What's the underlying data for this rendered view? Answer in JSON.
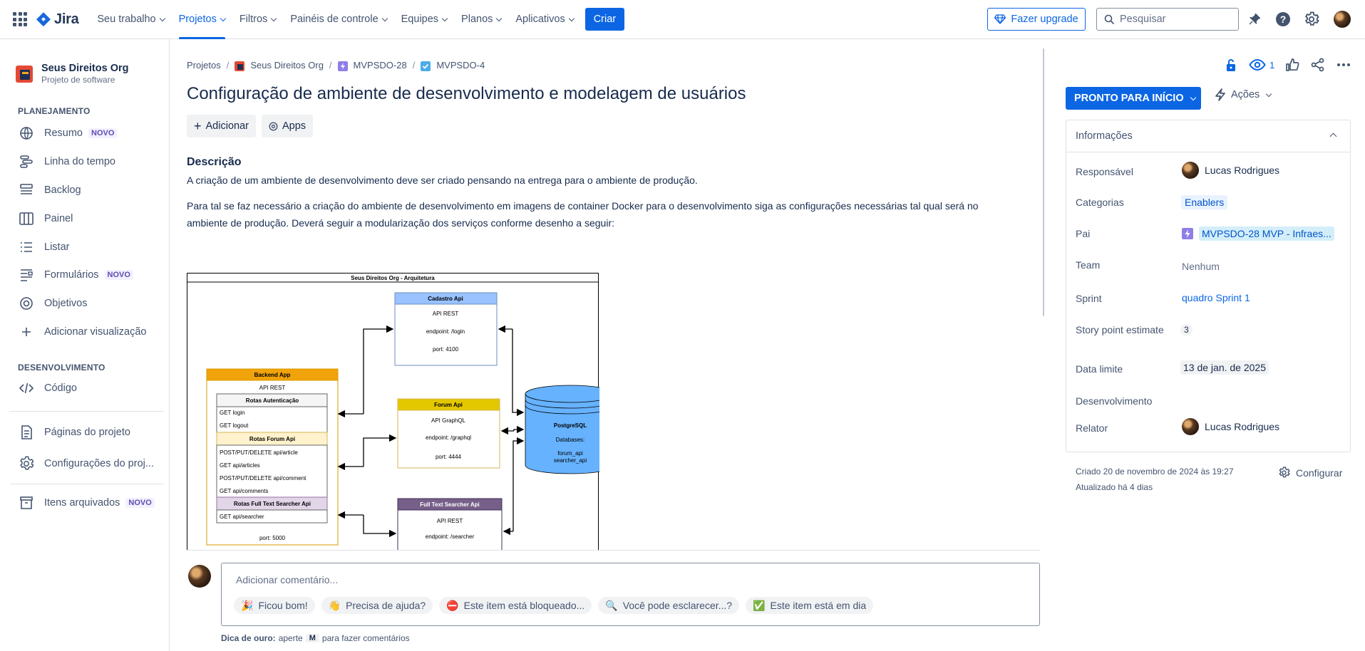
{
  "topnav": {
    "logo_text": "Jira",
    "items": [
      {
        "label": "Seu trabalho",
        "active": false
      },
      {
        "label": "Projetos",
        "active": true
      },
      {
        "label": "Filtros",
        "active": false
      },
      {
        "label": "Painéis de controle",
        "active": false
      },
      {
        "label": "Equipes",
        "active": false
      },
      {
        "label": "Planos",
        "active": false
      },
      {
        "label": "Aplicativos",
        "active": false
      }
    ],
    "create_label": "Criar",
    "upgrade_label": "Fazer upgrade",
    "search_placeholder": "Pesquisar"
  },
  "sidebar": {
    "project_name": "Seus Direitos Org",
    "project_type": "Projeto de software",
    "section_planning": "PLANEJAMENTO",
    "planning_items": [
      {
        "label": "Resumo",
        "badge": "NOVO",
        "icon": "globe-icon"
      },
      {
        "label": "Linha do tempo",
        "badge": "",
        "icon": "timeline-icon"
      },
      {
        "label": "Backlog",
        "badge": "",
        "icon": "backlog-icon"
      },
      {
        "label": "Painel",
        "badge": "",
        "icon": "board-icon"
      },
      {
        "label": "Listar",
        "badge": "",
        "icon": "list-icon"
      },
      {
        "label": "Formulários",
        "badge": "NOVO",
        "icon": "forms-icon"
      },
      {
        "label": "Objetivos",
        "badge": "",
        "icon": "target-icon"
      },
      {
        "label": "Adicionar visualização",
        "badge": "",
        "icon": "plus-icon"
      }
    ],
    "section_dev": "DESENVOLVIMENTO",
    "dev_items": [
      {
        "label": "Código",
        "icon": "code-icon"
      }
    ],
    "project_pages": "Páginas do projeto",
    "project_settings": "Configurações do proj...",
    "archived": "Itens arquivados",
    "archived_badge": "NOVO"
  },
  "breadcrumb": [
    "Projetos",
    "Seus Direitos Org",
    "MVPSDO-28",
    "MVPSDO-4"
  ],
  "issue": {
    "title": "Configuração de ambiente de desenvolvimento e modelagem de usuários",
    "add_label": "Adicionar",
    "apps_label": "Apps",
    "description_heading": "Descrição",
    "description_p1": "A criação de um ambiente de desenvolvimento deve ser criado pensando na entrega para o ambiente de produção.",
    "description_p2": "Para tal se faz necessário a criação do ambiente de desenvolvimento em imagens de container Docker para o desenvolvimento siga as configurações necessárias tal qual será no ambiente de produção. Deverá seguir a modularização dos serviços conforme desenho a seguir:"
  },
  "diagram": {
    "title": "Seus Direitos Org - Arquitetura",
    "cadastro": {
      "name": "Cadastro Api",
      "type": "API REST",
      "endpoint": "endpoint: /login",
      "port": "port: 4100"
    },
    "backend": {
      "name": "Backend App",
      "type": "API REST",
      "auth_title": "Rotas Autenticação",
      "auth_routes": [
        "GET login",
        "GET logout"
      ],
      "forum_title": "Rotas Forum Api",
      "forum_routes": [
        "POST/PUT/DELETE api/article",
        "GET api/articles",
        "POST/PUT/DELETE api/comment",
        "GET api/comments"
      ],
      "search_title": "Rotas Full Text Searcher Api",
      "search_routes": [
        "GET api/searcher"
      ],
      "port": "port: 5000"
    },
    "forum": {
      "name": "Forum Api",
      "type": "API GraphQL",
      "endpoint": "endpoint: /graphql",
      "port": "port: 4444"
    },
    "searcher": {
      "name": "Full Text Searcher Api",
      "type": "API REST",
      "endpoint": "endpoint: /searcher"
    },
    "db": {
      "name": "PostgreSQL",
      "label": "Databases:",
      "dbs": [
        "forum_api",
        "searcher_api"
      ]
    },
    "colors": {
      "cadastro": "#99c2ff",
      "backend": "#f0a30a",
      "forum": "#e3c800",
      "searcher": "#76608a",
      "db": "#66b2ff"
    }
  },
  "comment": {
    "placeholder": "Adicionar comentário...",
    "chips": [
      {
        "emoji": "🎉",
        "label": "Ficou bom!"
      },
      {
        "emoji": "👋",
        "label": "Precisa de ajuda?"
      },
      {
        "emoji": "⛔",
        "label": "Este item está bloqueado..."
      },
      {
        "emoji": "🔍",
        "label": "Você pode esclarecer...?"
      },
      {
        "emoji": "✅",
        "label": "Este item está em dia"
      }
    ],
    "tip_bold": "Dica de ouro:",
    "tip_text1": "aperte",
    "tip_key": "M",
    "tip_text2": "para fazer comentários"
  },
  "right": {
    "watchers": "1",
    "status": "PRONTO PARA INÍCIO",
    "actions": "Ações",
    "info_title": "Informações",
    "fields": {
      "assignee_label": "Responsável",
      "assignee": "Lucas Rodrigues",
      "categories_label": "Categorias",
      "categories": "Enablers",
      "parent_label": "Pai",
      "parent": "MVPSDO-28 MVP - Infraes...",
      "team_label": "Team",
      "team": "Nenhum",
      "sprint_label": "Sprint",
      "sprint": "quadro Sprint 1",
      "points_label": "Story point estimate",
      "points": "3",
      "due_label": "Data limite",
      "due": "13 de jan. de 2025",
      "dev_label": "Desenvolvimento",
      "reporter_label": "Relator",
      "reporter": "Lucas Rodrigues"
    },
    "created": "Criado 20 de novembro de 2024 às 19:27",
    "updated": "Atualizado há 4 dias",
    "configure": "Configurar"
  }
}
